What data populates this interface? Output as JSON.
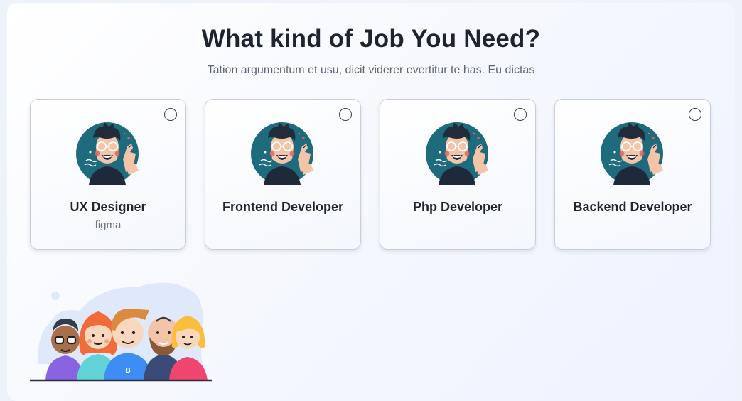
{
  "header": {
    "title": "What kind of Job You Need?",
    "subtitle": "Tation argumentum et usu, dicit viderer evertitur te has. Eu dictas"
  },
  "jobs": [
    {
      "title": "UX Designer",
      "subtitle": "figma",
      "selected": false
    },
    {
      "title": "Frontend Developer",
      "subtitle": "",
      "selected": false
    },
    {
      "title": "Php Developer",
      "subtitle": "",
      "selected": false
    },
    {
      "title": "Backend Developer",
      "subtitle": "",
      "selected": false
    }
  ],
  "icons": {
    "avatar": "developer-avatar-icon",
    "radio": "radio-button",
    "team": "team-illustration"
  },
  "colors": {
    "avatar_bg": "#1f6b7e",
    "card_border": "#c9ced6",
    "title": "#1d2430"
  }
}
